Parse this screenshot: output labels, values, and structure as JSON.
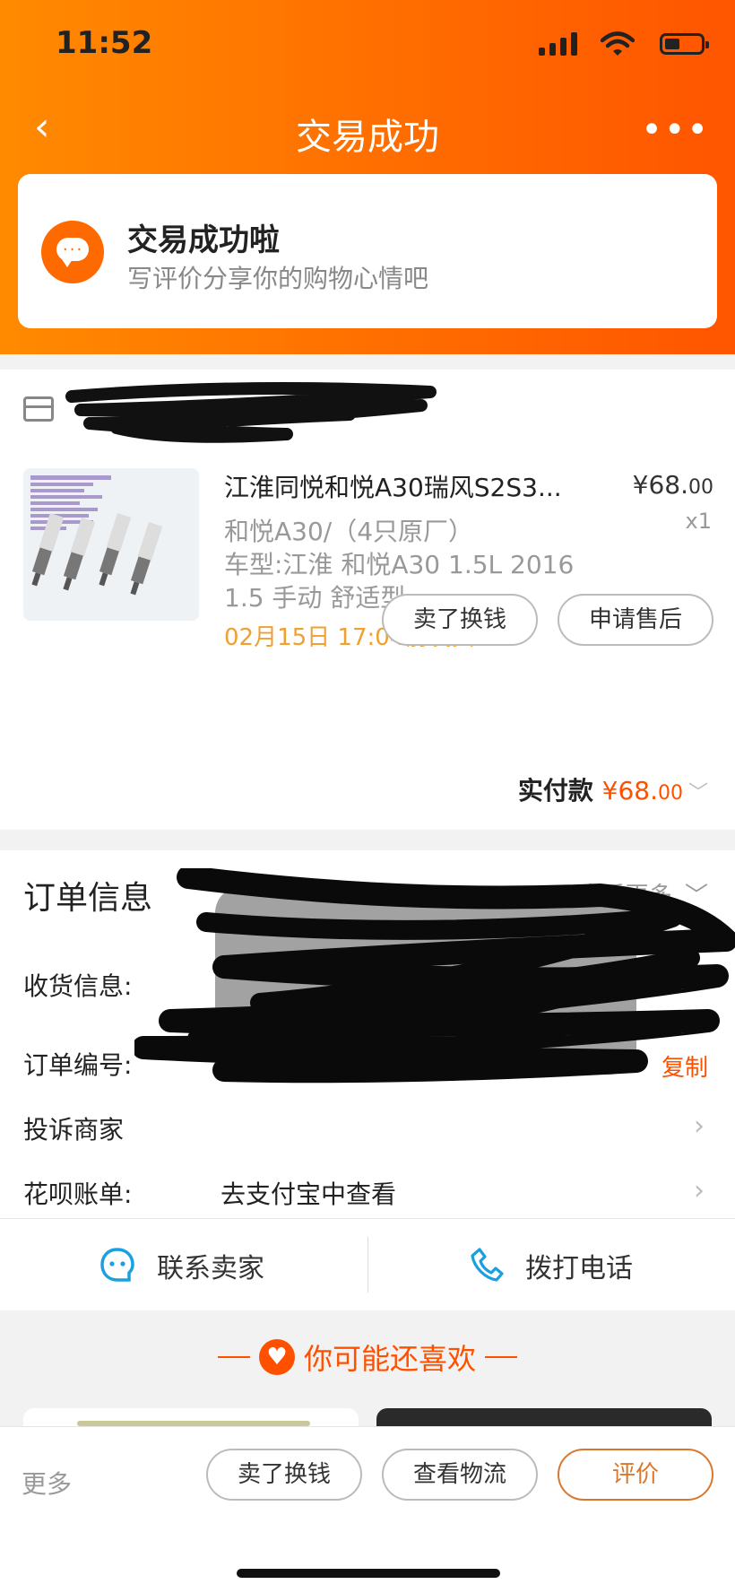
{
  "status_bar": {
    "time": "11:52"
  },
  "nav": {
    "back": "‹",
    "title": "交易成功",
    "more": "•••"
  },
  "status_card": {
    "title": "交易成功啦",
    "subtitle": "写评价分享你的购物心情吧",
    "icon": "message-bubble-icon"
  },
  "product": {
    "name": "江淮同悦和悦A30瑞风S2S3...",
    "price_main": "¥68.",
    "price_cents": "00",
    "qty": "x1",
    "spec_lines": [
      "和悦A30/（4只原厂）",
      "车型:江淮 和悦A30 1.5L 2016",
      "1.5 手动 舒适型"
    ],
    "ship_date": "02月15日 17:04前发货",
    "btn_sell": "卖了换钱",
    "btn_aftersale": "申请售后",
    "paid_label": "实付款",
    "paid_main": "¥68.",
    "paid_cents": "00"
  },
  "order_info": {
    "title": "订单信息",
    "more": "查看更多",
    "receive_label": "收货信息:",
    "order_no_label": "订单编号:",
    "copy": "复制",
    "complaint_label": "投诉商家",
    "huabei_label": "花呗账单:",
    "huabei_value": "去支付宝中查看"
  },
  "contact": {
    "seller": "联系卖家",
    "phone": "拨打电话"
  },
  "recommend": {
    "title": "你可能还喜欢"
  },
  "bottom_bar": {
    "more": "更多",
    "sell": "卖了换钱",
    "logistics": "查看物流",
    "evaluate": "评价"
  },
  "colors": {
    "accent": "#ff5000",
    "header_start": "#ff8a00",
    "eval_border": "#d9772e"
  }
}
